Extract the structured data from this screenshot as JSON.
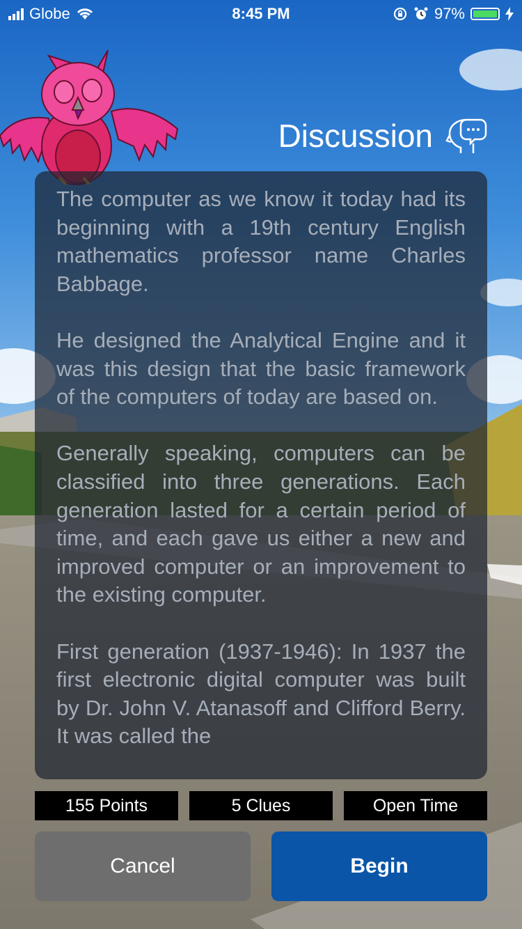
{
  "status_bar": {
    "carrier": "Globe",
    "time": "8:45 PM",
    "battery": "97%"
  },
  "header": {
    "title": "Discussion",
    "icon": "head-speech-bubble-icon"
  },
  "mascot": "owl-mascot",
  "discussion": {
    "paragraphs": [
      "The computer as we know it today had its beginning with a 19th century English mathematics professor name Charles Babbage.",
      "He designed the Analytical Engine and it was this design that the basic framework of the computers of today are based on.",
      "Generally speaking, computers can be classified into three generations. Each generation lasted for a certain period of time, and each gave us either a new and improved computer or an improvement to the existing computer.",
      "First generation (1937-1946): In 1937 the first electronic digital computer was built by Dr. John V. Atanasoff and Clifford Berry. It was called the"
    ]
  },
  "stats": {
    "points": "155 Points",
    "clues": "5 Clues",
    "time": "Open Time"
  },
  "actions": {
    "cancel": "Cancel",
    "begin": "Begin"
  },
  "colors": {
    "panel": "#1e2632",
    "panel_text": "#a6aeb9",
    "begin_button": "#0a55a8",
    "cancel_button": "#6e6e6e",
    "battery": "#4cd964"
  }
}
